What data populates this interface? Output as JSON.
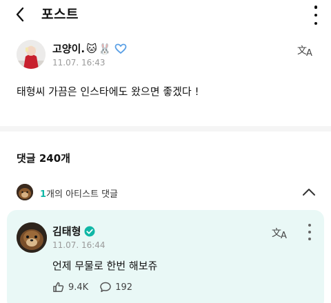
{
  "header": {
    "title": "포스트",
    "icons": [
      "back-arrow-icon",
      "more-vertical-icon"
    ]
  },
  "post": {
    "author": "고양이.",
    "author_emojis": [
      "🐱",
      "🐰"
    ],
    "badge_icon": "heart-outline-badge-icon",
    "time": "11.07. 16:43",
    "body": "태형씨 가끔은 인스타에도 왔으면 좋겠다 !",
    "translate_icon": "translate-icon"
  },
  "comments": {
    "count_label": "댓글 240개"
  },
  "artist_comments": {
    "count": "1",
    "label": "개의 아티스트 댓글",
    "expanded": true
  },
  "artist_comment": {
    "name": "김태형",
    "verified_icon": "verified-badge-icon",
    "time": "11.07. 16:44",
    "text": "언제 무물로 한번 해보쥬",
    "likes": "9.4K",
    "replies": "192"
  },
  "colors": {
    "accent": "#10b7a6",
    "card_bg": "#e9f8f6",
    "divider": "#f5f5f5",
    "meta_text": "#9a9a9a"
  }
}
